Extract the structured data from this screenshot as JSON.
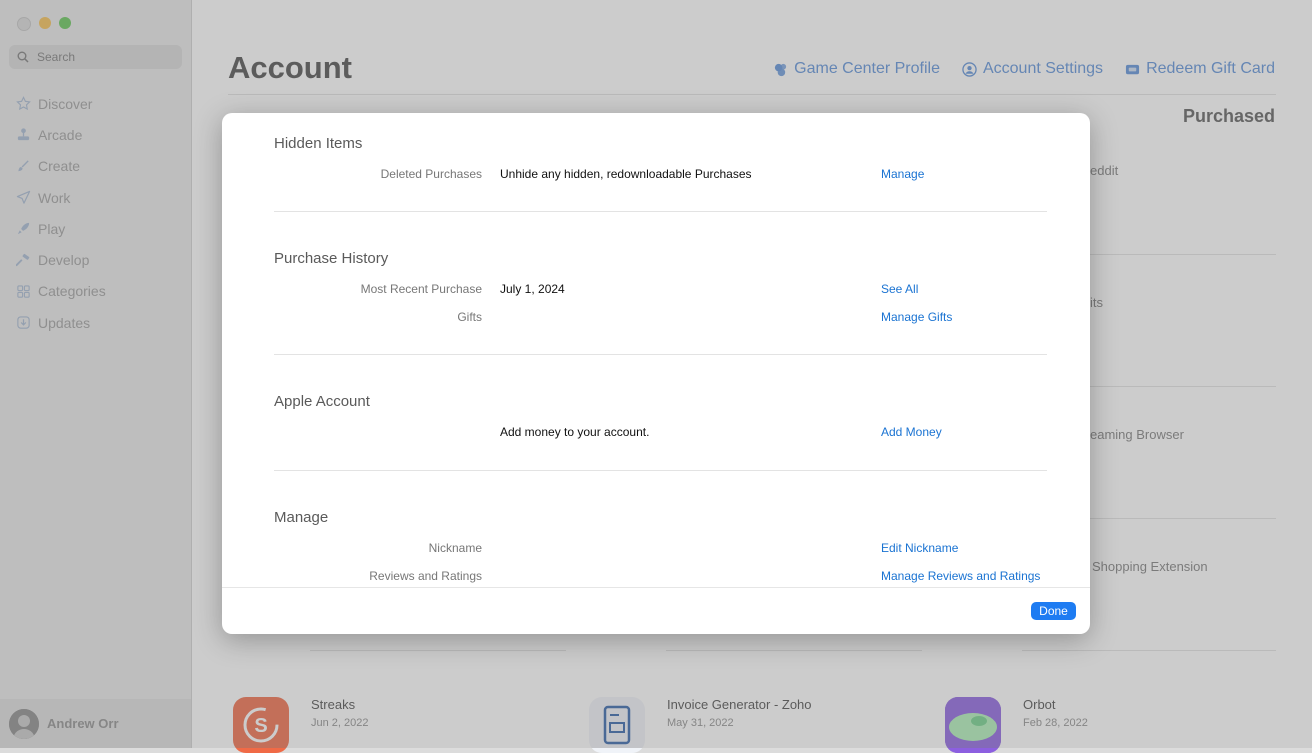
{
  "sidebar": {
    "search_placeholder": "Search",
    "items": [
      {
        "label": "Discover",
        "icon": "star-icon"
      },
      {
        "label": "Arcade",
        "icon": "joystick-icon"
      },
      {
        "label": "Create",
        "icon": "brush-icon"
      },
      {
        "label": "Work",
        "icon": "paperplane-icon"
      },
      {
        "label": "Play",
        "icon": "rocket-icon"
      },
      {
        "label": "Develop",
        "icon": "hammer-icon"
      },
      {
        "label": "Categories",
        "icon": "grid-icon"
      },
      {
        "label": "Updates",
        "icon": "download-icon"
      }
    ],
    "user": {
      "name": "Andrew Orr"
    }
  },
  "main": {
    "title": "Account",
    "links": {
      "game_center": "Game Center Profile",
      "account_settings": "Account Settings",
      "redeem": "Redeem Gift Card"
    },
    "purchased_label": "Purchased",
    "behind_text": {
      "reddit": "eddit",
      "its": "its",
      "browser": "eaming Browser",
      "shopping": "Shopping Extension"
    },
    "apps": [
      {
        "name": "Streaks",
        "date": "Jun 2, 2022"
      },
      {
        "name": "Invoice Generator - Zoho",
        "date": "May 31, 2022"
      },
      {
        "name": "Orbot",
        "date": "Feb 28, 2022"
      }
    ]
  },
  "modal": {
    "hidden_items": {
      "title": "Hidden Items",
      "label": "Deleted Purchases",
      "value": "Unhide any hidden, redownloadable Purchases",
      "action": "Manage"
    },
    "purchase_history": {
      "title": "Purchase History",
      "recent_label": "Most Recent Purchase",
      "recent_value": "July 1, 2024",
      "recent_action": "See All",
      "gifts_label": "Gifts",
      "gifts_action": "Manage Gifts"
    },
    "apple_account": {
      "title": "Apple Account",
      "value": "Add money to your account.",
      "action": "Add Money"
    },
    "manage": {
      "title": "Manage",
      "nickname_label": "Nickname",
      "nickname_action": "Edit Nickname",
      "reviews_label": "Reviews and Ratings",
      "reviews_action": "Manage Reviews and Ratings"
    },
    "done_label": "Done"
  },
  "colors": {
    "accent": "#1e7cf2",
    "link": "#1a73d2"
  }
}
